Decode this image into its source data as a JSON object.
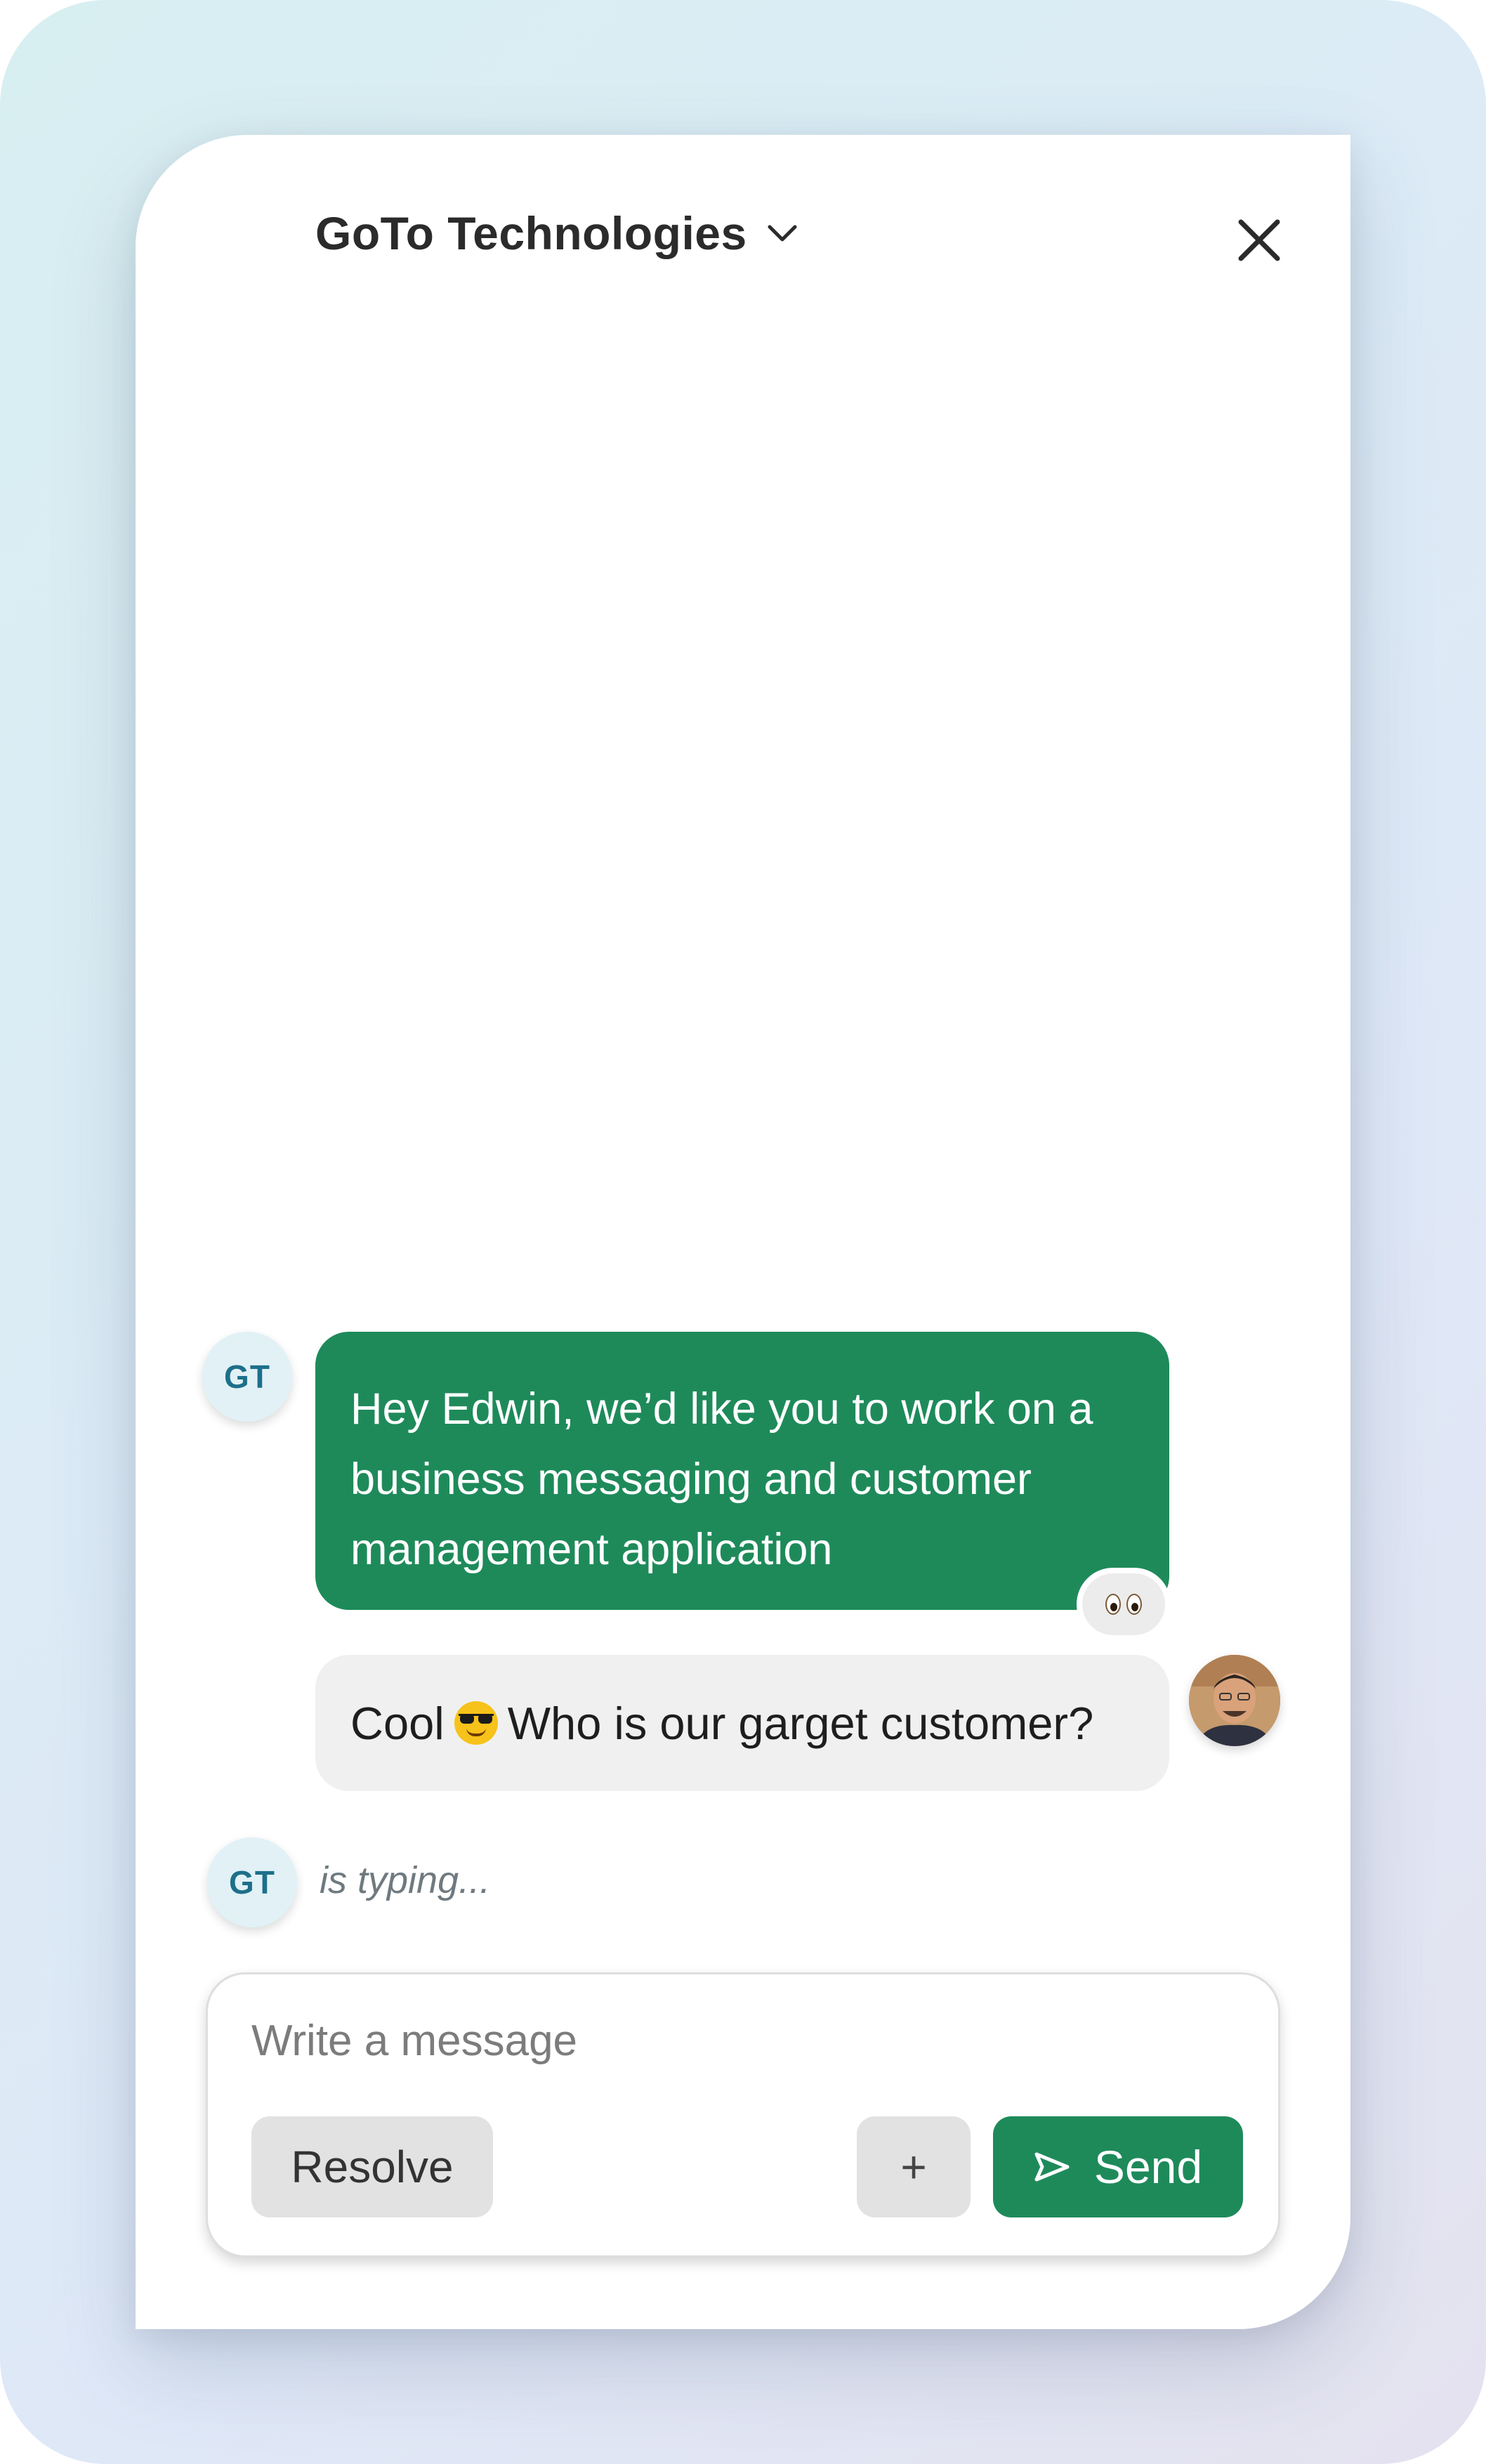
{
  "header": {
    "title": "GoTo Technologies",
    "dropdown_icon": "chevron-down-icon",
    "close_icon": "close-icon"
  },
  "messages": [
    {
      "sender_initials": "GT",
      "text": "Hey Edwin, we’d like you to work on a business messaging and customer management application",
      "reaction": "eyes",
      "bubble_color": "#1e8a5a"
    },
    {
      "sender": "user",
      "text_before_emoji": "Cool",
      "emoji": "smiling-face-with-sunglasses",
      "text_after_emoji": "Who is our garget customer?",
      "bubble_color": "#f0f0f0"
    }
  ],
  "typing": {
    "sender_initials": "GT",
    "text": "is typing..."
  },
  "composer": {
    "placeholder": "Write a message",
    "resolve_label": "Resolve",
    "attach_label": "+",
    "send_label": "Send",
    "send_icon": "send-icon"
  },
  "colors": {
    "accent": "#1e8a5a",
    "avatar_bg": "#e1f1f6",
    "avatar_text": "#1d6f8a"
  }
}
